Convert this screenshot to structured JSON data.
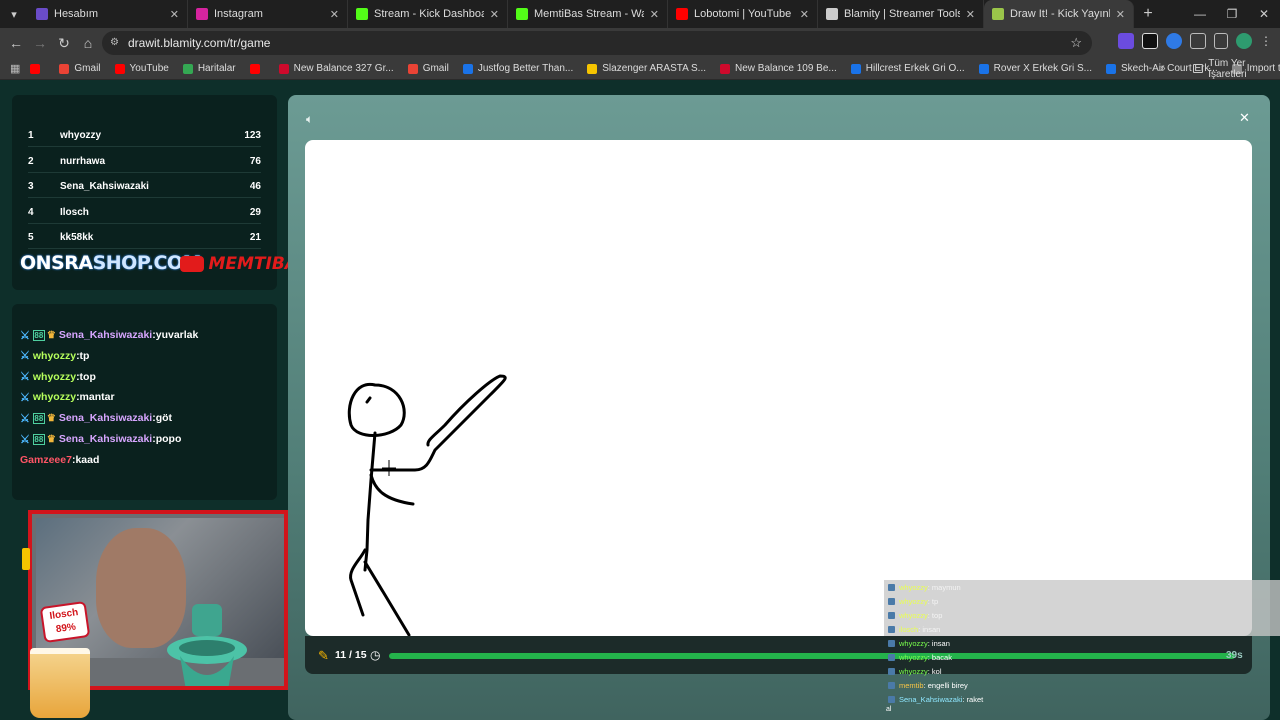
{
  "browser": {
    "tabs": [
      {
        "title": "Hesabım",
        "color": "#6a4cc8",
        "active": false
      },
      {
        "title": "Instagram",
        "color": "#d6249f",
        "active": false
      },
      {
        "title": "Stream - Kick Dashboard",
        "color": "#53fc18",
        "active": false
      },
      {
        "title": "MemtiBas Stream - Watch Live",
        "color": "#53fc18",
        "active": false
      },
      {
        "title": "Lobotomi | YouTube Music",
        "color": "#ff0000",
        "active": false
      },
      {
        "title": "Blamity | Streamer Tools & Parti",
        "color": "#cccccc",
        "active": false
      },
      {
        "title": "Draw It! - Kick Yayınları İçin Çiz",
        "color": "#9ac54a",
        "active": true
      }
    ],
    "url": "drawit.blamity.com/tr/game",
    "bookmarks": [
      {
        "label": "",
        "color": "#ff0000"
      },
      {
        "label": "Gmail",
        "color": "#ea4335"
      },
      {
        "label": "YouTube",
        "color": "#ff0000"
      },
      {
        "label": "Haritalar",
        "color": "#34a853"
      },
      {
        "label": "",
        "color": "#ff0000"
      },
      {
        "label": "New Balance 327 Gr...",
        "color": "#cf0a2c"
      },
      {
        "label": "Gmail",
        "color": "#ea4335"
      },
      {
        "label": "Justfog Better Than...",
        "color": "#1a73e8"
      },
      {
        "label": "Slazenger ARASTA S...",
        "color": "#f5c400"
      },
      {
        "label": "New Balance 109 Be...",
        "color": "#cf0a2c"
      },
      {
        "label": "Hillcrest Erkek Gri O...",
        "color": "#1a73e8"
      },
      {
        "label": "Rover X Erkek Gri S...",
        "color": "#1a73e8"
      },
      {
        "label": "Skech-Air Court Erk...",
        "color": "#1a73e8"
      },
      {
        "label": "Import to Air Reviews",
        "color": "#888888"
      }
    ],
    "all_bookmarks": "Tüm Yer İşaretleri"
  },
  "leaderboard": [
    {
      "rank": "1",
      "name": "whyozzy",
      "score": "123"
    },
    {
      "rank": "2",
      "name": "nurrhawa",
      "score": "76"
    },
    {
      "rank": "3",
      "name": "Sena_Kahsiwazaki",
      "score": "46"
    },
    {
      "rank": "4",
      "name": "Ilosch",
      "score": "29"
    },
    {
      "rank": "5",
      "name": "kk58kk",
      "score": "21"
    }
  ],
  "brand": {
    "onsra": "ONSRA",
    "shop": "SHOP.COM",
    "memtiba": "MEMTIBA"
  },
  "chat": [
    {
      "user": "Sena_Kahsiwazaki",
      "msg": ":yuvarlak",
      "color": "purple",
      "badges": true
    },
    {
      "user": "whyozzy",
      "msg": ":tp",
      "color": "green",
      "badges": false
    },
    {
      "user": "whyozzy",
      "msg": ":top",
      "color": "green",
      "badges": false
    },
    {
      "user": "whyozzy",
      "msg": ":mantar",
      "color": "green",
      "badges": false
    },
    {
      "user": "Sena_Kahsiwazaki",
      "msg": ":göt",
      "color": "purple",
      "badges": true
    },
    {
      "user": "Sena_Kahsiwazaki",
      "msg": ":popo",
      "color": "purple",
      "badges": true
    },
    {
      "user": "Gamzeee7",
      "msg": ":kaad",
      "color": "red",
      "badges": false
    }
  ],
  "webcam_tag": {
    "name": "Ilosch",
    "percent": "89%"
  },
  "game": {
    "round": "11 / 15",
    "timer": "39s",
    "progress": 0.92
  },
  "overlay_chat": [
    {
      "user": "whyozzy",
      "msg": ": maymun",
      "style": "gray",
      "color": "g"
    },
    {
      "user": "whyozzy",
      "msg": ": tp",
      "style": "gray",
      "color": "g"
    },
    {
      "user": "whyozzy",
      "msg": ": top",
      "style": "gray",
      "color": "g"
    },
    {
      "user": "ilosch",
      "msg": ": insan",
      "style": "gray",
      "color": "g"
    },
    {
      "user": "whyozzy",
      "msg": ": insan",
      "style": "dark",
      "color": "g"
    },
    {
      "user": "whyozzy",
      "msg": ": bacak",
      "style": "dark",
      "color": "g"
    },
    {
      "user": "whyozzy",
      "msg": ": kol",
      "style": "dark",
      "color": "g"
    },
    {
      "user": "memtib",
      "msg": ": engelli birey",
      "style": "dark",
      "color": "o"
    },
    {
      "user": "Sena_Kahsiwazaki",
      "msg": ": raket",
      "style": "dark",
      "color": "c"
    }
  ],
  "overlay_last": "al"
}
